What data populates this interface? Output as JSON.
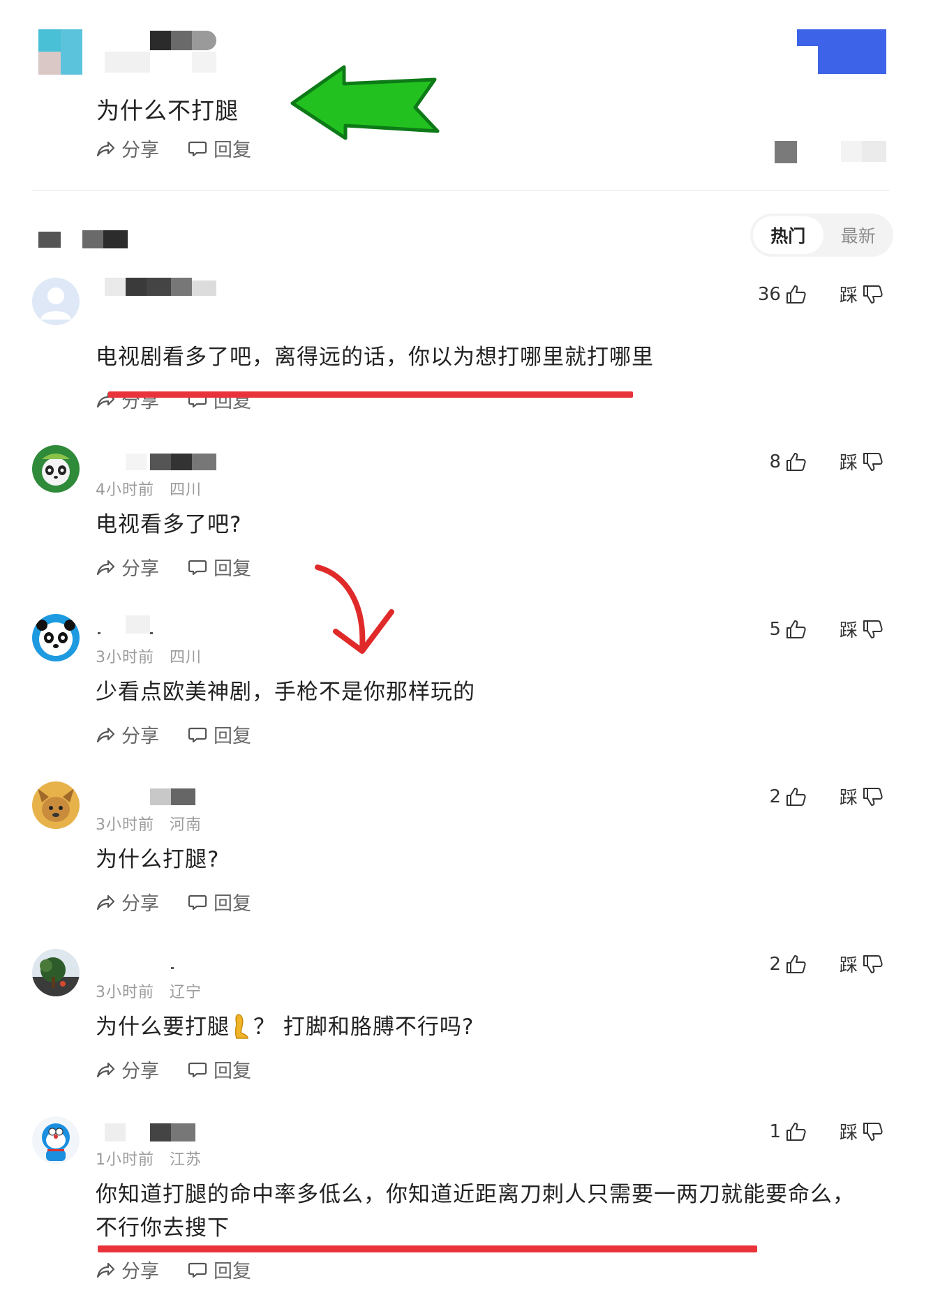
{
  "post": {
    "text": "为什么不打腿",
    "share_label": "分享",
    "reply_label": "回复"
  },
  "sort_tabs": [
    {
      "label": "热门",
      "active": true
    },
    {
      "label": "最新",
      "active": false
    }
  ],
  "comments": [
    {
      "time": "",
      "location": "",
      "text": "电视剧看多了吧，离得远的话，你以为想打哪里就打哪里",
      "likes": "36",
      "dislike_label": "踩",
      "share_label": "分享",
      "reply_label": "回复",
      "avatar": "default-user-avatar"
    },
    {
      "time": "4小时前",
      "location": "四川",
      "text": "电视看多了吧?",
      "likes": "8",
      "dislike_label": "踩",
      "share_label": "分享",
      "reply_label": "回复",
      "avatar": "green-panda-avatar"
    },
    {
      "time": "3小时前",
      "location": "四川",
      "text": "少看点欧美神剧，手枪不是你那样玩的",
      "likes": "5",
      "dislike_label": "踩",
      "share_label": "分享",
      "reply_label": "回复",
      "avatar": "panda-avatar"
    },
    {
      "time": "3小时前",
      "location": "河南",
      "text": "为什么打腿?",
      "likes": "2",
      "dislike_label": "踩",
      "share_label": "分享",
      "reply_label": "回复",
      "avatar": "dog-avatar"
    },
    {
      "time": "3小时前",
      "location": "辽宁",
      "text": "为什么要打腿",
      "text_after_emoji": "？ 打脚和胳膊不行吗?",
      "likes": "2",
      "dislike_label": "踩",
      "share_label": "分享",
      "reply_label": "回复",
      "avatar": "tree-photo-avatar",
      "emoji": "leg-emoji"
    },
    {
      "time": "1小时前",
      "location": "江苏",
      "text": "你知道打腿的命中率多低么，你知道近距离刀刺人只需要一两刀就能要命么，",
      "text_line2": "不行你去搜下",
      "likes": "1",
      "dislike_label": "踩",
      "share_label": "分享",
      "reply_label": "回复",
      "avatar": "doraemon-avatar"
    }
  ],
  "colors": {
    "annotation_red": "#e8333b",
    "annotation_green": "#22c11f",
    "blue_block": "#3d63e8"
  },
  "icons": [
    "share-icon",
    "reply-icon",
    "like-icon",
    "dislike-icon",
    "green-arrow-annotation",
    "red-arrow-annotation"
  ]
}
